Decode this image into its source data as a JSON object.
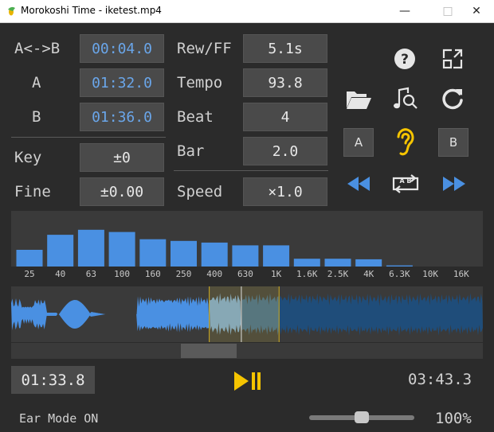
{
  "window": {
    "title": "Morokoshi Time - iketest.mp4"
  },
  "loop_panel": {
    "ab_label": "A<->B",
    "ab_value": "00:04.0",
    "a_label": "A",
    "a_value": "01:32.0",
    "b_label": "B",
    "b_value": "01:36.0",
    "key_label": "Key",
    "key_value": "±0",
    "fine_label": "Fine",
    "fine_value": "±0.00"
  },
  "tempo_panel": {
    "rewff_label": "Rew/FF",
    "rewff_value": "5.1s",
    "tempo_label": "Tempo",
    "tempo_value": "93.8",
    "beat_label": "Beat",
    "beat_value": "4",
    "bar_label": "Bar",
    "bar_value": "2.0",
    "speed_label": "Speed",
    "speed_value": "×1.0"
  },
  "buttons": {
    "set_a_label": "A",
    "set_b_label": "B",
    "loop_icon_text": "A B"
  },
  "icons": [
    "help-icon",
    "resize-icon",
    "folder-icon",
    "music-search-icon",
    "refresh-icon",
    "ear-icon",
    "rewind-icon",
    "loop-icon",
    "fast-forward-icon",
    "play-pause-icon"
  ],
  "colors": {
    "accent_blue": "#4a90e2",
    "ear_yellow": "#f5c400",
    "play_yellow": "#f5c400",
    "loop_region": "#c8b040"
  },
  "spectrum": {
    "bands": [
      "25",
      "40",
      "63",
      "100",
      "160",
      "250",
      "400",
      "630",
      "1K",
      "1.6K",
      "2.5K",
      "4K",
      "6.3K",
      "10K",
      "16K"
    ],
    "levels": [
      0.3,
      0.57,
      0.66,
      0.62,
      0.49,
      0.46,
      0.43,
      0.38,
      0.38,
      0.14,
      0.14,
      0.13,
      0.02,
      0,
      0
    ]
  },
  "waveform": {
    "loop_start_fraction": 0.42,
    "loop_end_fraction": 0.568,
    "playhead_fraction": 0.488,
    "scroll_position": 0.36
  },
  "transport": {
    "current_time": "01:33.8",
    "total_time": "03:43.3"
  },
  "status_bar": {
    "mode": "Ear Mode ON",
    "zoom": "100%",
    "zoom_slider_fraction": 0.5
  }
}
